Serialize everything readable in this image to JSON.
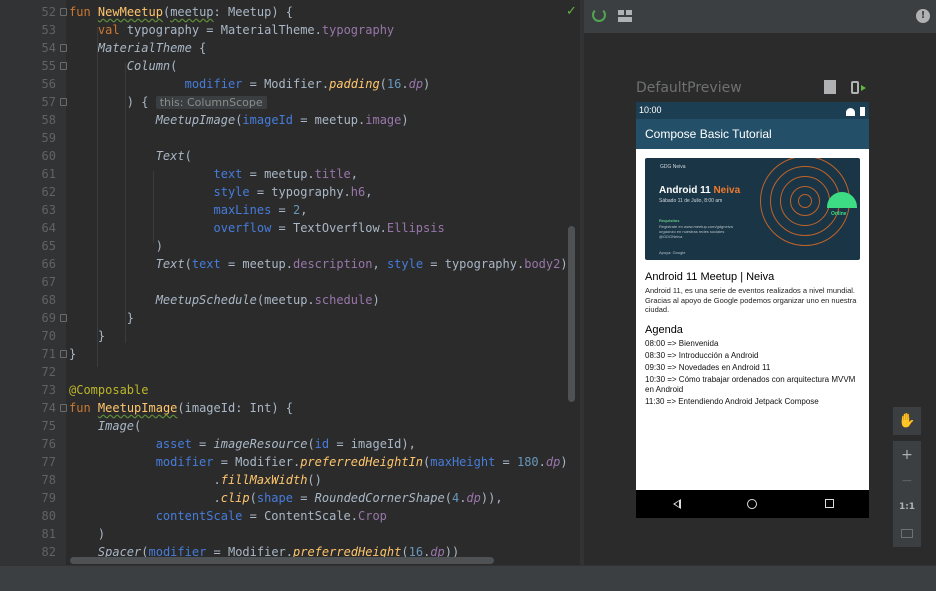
{
  "editor": {
    "lines": [
      {
        "n": "52"
      },
      {
        "n": "53"
      },
      {
        "n": "54"
      },
      {
        "n": "55"
      },
      {
        "n": "56"
      },
      {
        "n": "57"
      },
      {
        "n": "58"
      },
      {
        "n": "59"
      },
      {
        "n": "60"
      },
      {
        "n": "61"
      },
      {
        "n": "62"
      },
      {
        "n": "63"
      },
      {
        "n": "64"
      },
      {
        "n": "65"
      },
      {
        "n": "66"
      },
      {
        "n": "67"
      },
      {
        "n": "68"
      },
      {
        "n": "69"
      },
      {
        "n": "70"
      },
      {
        "n": "71"
      },
      {
        "n": "72"
      },
      {
        "n": "73"
      },
      {
        "n": "74"
      },
      {
        "n": "75"
      },
      {
        "n": "76"
      },
      {
        "n": "77"
      },
      {
        "n": "78"
      },
      {
        "n": "79"
      },
      {
        "n": "80"
      },
      {
        "n": "81"
      },
      {
        "n": "82"
      }
    ],
    "inlay_hint": "this: ColumnScope"
  },
  "preview": {
    "name": "DefaultPreview",
    "status_time": "10:00",
    "app_title": "Compose Basic Tutorial",
    "banner": {
      "gdg": "GDG Neiva",
      "title_a": "Android 11 ",
      "title_b": "Neiva",
      "date": "Sábado 11 de Julio, 8:00 am",
      "req_label": "Requisitos",
      "req_text": "Registrate en www.meetup.com/gdgneiva orgaonzo en nuestras redes sociales @GDGNeiva",
      "sponsor": "Apoya: Google",
      "online": "Online"
    },
    "meetup_title": "Android 11 Meetup | Neiva",
    "meetup_description": "Android 11, es una serie de eventos realizados a nivel mundial. Gracias al apoyo de Google podemos organizar uno en nuestra ciudad.",
    "agenda_title": "Agenda",
    "agenda": [
      "08:00 => Bienvenida",
      "08:30 => Introducción a Android",
      "09:30 => Novedades en Android 11",
      "10:30 => Cómo trabajar ordenados con arquitectura MVVM en Android",
      "11:30 => Entendiendo Android Jetpack Compose"
    ]
  },
  "zoom": {
    "zoom_in": "+",
    "zoom_out": "−",
    "actual_size": "1:1"
  },
  "icons": {
    "issues": "!",
    "check": "✓"
  },
  "colors": {
    "editor_bg": "#2b2b2b",
    "keyword": "#cc7832",
    "function": "#ffc66d",
    "property": "#9876aa",
    "param": "#467cda",
    "number": "#6897bb",
    "annotation": "#bbb529",
    "app_bar": "#234f68"
  }
}
